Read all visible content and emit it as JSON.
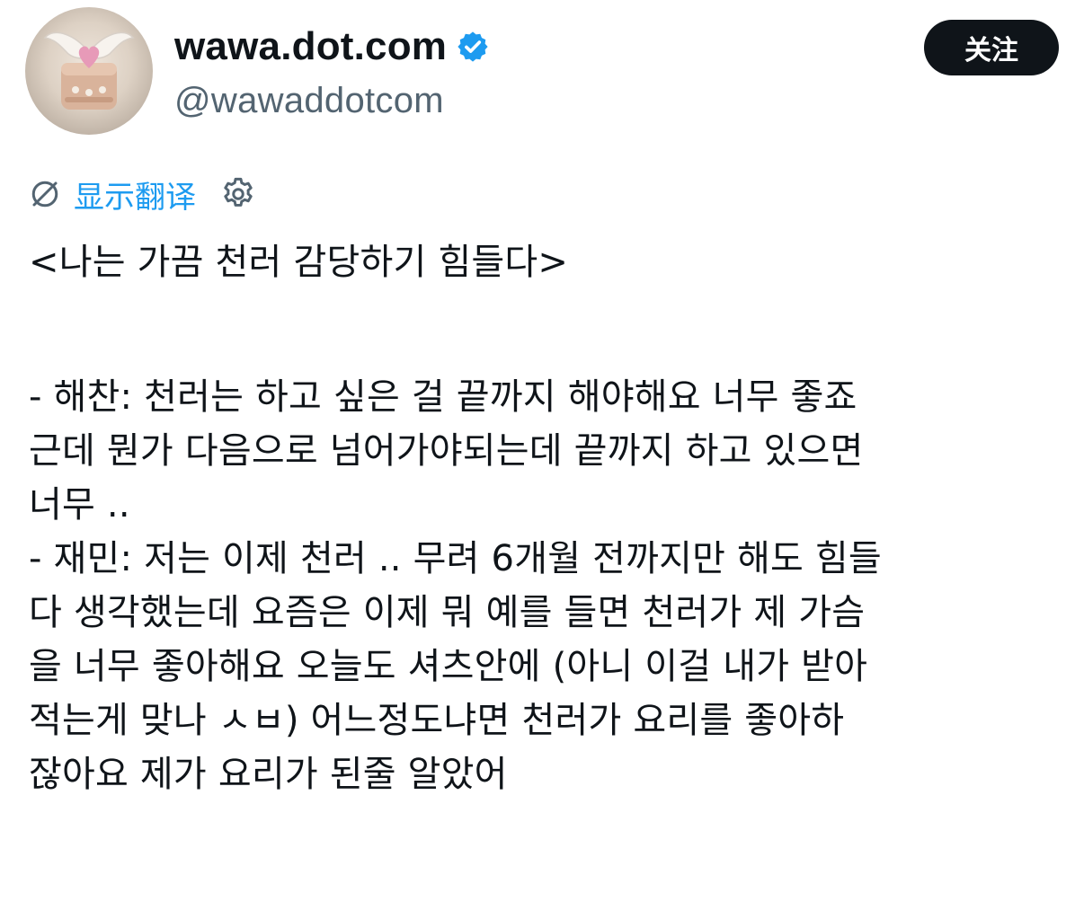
{
  "profile": {
    "display_name": "wawa.dot.com",
    "handle": "@wawaddotcom",
    "verified": true,
    "avatar_icon": "angel-wing-heart-cake-avatar"
  },
  "follow_button": {
    "label": "关注"
  },
  "translate": {
    "label": "显示翻译",
    "icon": "translate-globe-icon",
    "settings_icon": "gear-icon"
  },
  "tweet": {
    "title": "<나는 가끔 천러 감당하기 힘들다>",
    "lines": [
      "- 해찬: 천러는 하고 싶은 걸 끝까지 해야해요 너무 좋죠",
      "근데 뭔가 다음으로 넘어가야되는데 끝까지 하고 있으면",
      "너무 ..",
      "- 재민: 저는 이제 천러 .. 무려 6개월 전까지만 해도 힘들",
      "다 생각했는데 요즘은 이제 뭐 예를 들면 천러가 제 가슴",
      "을 너무 좋아해요 오늘도 셔츠안에 (아니 이걸 내가 받아",
      "적는게 맞나 ㅅㅂ) 어느정도냐면 천러가 요리를 좋아하",
      "잖아요 제가 요리가 된줄 알았어"
    ]
  },
  "colors": {
    "text": "#0f1419",
    "secondary": "#536471",
    "accent": "#1d9bf0",
    "button_bg": "#0f1419"
  }
}
